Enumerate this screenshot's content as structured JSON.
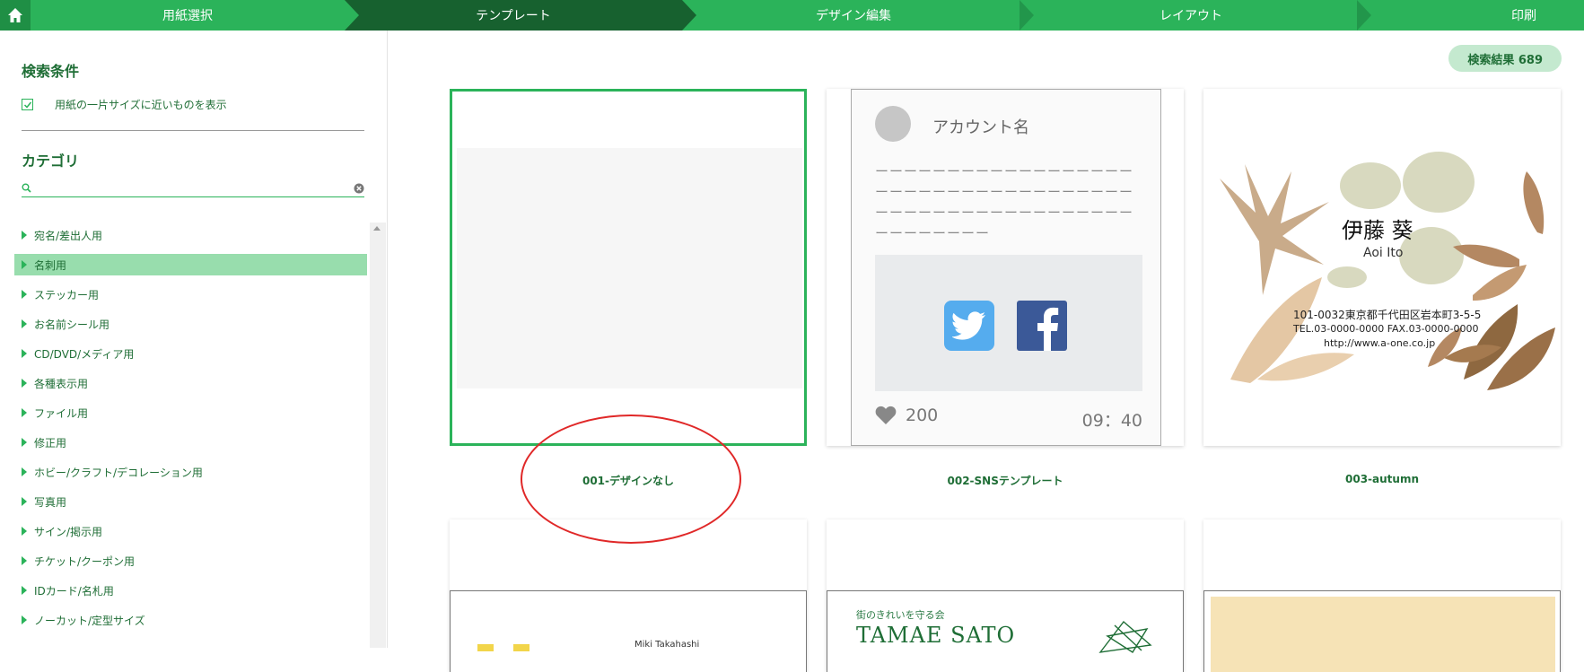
{
  "steps": [
    {
      "label": "用紙選択",
      "active": false
    },
    {
      "label": "テンプレート",
      "active": true
    },
    {
      "label": "デザイン編集",
      "active": false
    },
    {
      "label": "レイアウト",
      "active": false
    },
    {
      "label": "印刷",
      "active": false
    }
  ],
  "sidebar": {
    "search_heading": "検索条件",
    "checkbox_label": "用紙の一片サイズに近いものを表示",
    "category_heading": "カテゴリ",
    "category_search_placeholder": "",
    "categories": [
      {
        "label": "宛名/差出人用",
        "selected": false
      },
      {
        "label": "名刺用",
        "selected": true
      },
      {
        "label": "ステッカー用",
        "selected": false
      },
      {
        "label": "お名前シール用",
        "selected": false
      },
      {
        "label": "CD/DVD/メディア用",
        "selected": false
      },
      {
        "label": "各種表示用",
        "selected": false
      },
      {
        "label": "ファイル用",
        "selected": false
      },
      {
        "label": "修正用",
        "selected": false
      },
      {
        "label": "ホビー/クラフト/デコレーション用",
        "selected": false
      },
      {
        "label": "写真用",
        "selected": false
      },
      {
        "label": "サイン/掲示用",
        "selected": false
      },
      {
        "label": "チケット/クーポン用",
        "selected": false
      },
      {
        "label": "IDカード/名札用",
        "selected": false
      },
      {
        "label": "ノーカット/定型サイズ",
        "selected": false
      }
    ]
  },
  "results": {
    "badge": "検索結果 689"
  },
  "templates": [
    {
      "label": "001-デザインなし",
      "selected": true
    },
    {
      "label": "002-SNSテンプレート",
      "selected": false,
      "account": "アカウント名",
      "dashes": "ーーーーーーーーーーーーーーーーーーーーーーーーーーーーーーーーーーーーーーーーーーーーーーーーーーーーーーーーーーーーーー",
      "likes": "200",
      "time": "09：40"
    },
    {
      "label": "003-autumn",
      "selected": false,
      "name": "伊藤 葵",
      "roman": "Aoi Ito",
      "address": "101-0032東京都千代田区岩本町3-5-5",
      "tel": "TEL.03-0000-0000   FAX.03-0000-0000",
      "url": "http://www.a-one.co.jp"
    }
  ],
  "row2": [
    {
      "text": "Miki Takahashi"
    },
    {
      "sub": "街のきれいを守る会",
      "title": "TAMAE SATO"
    },
    {}
  ],
  "colors": {
    "brand_green": "#2bb35a",
    "active_step": "#17612f",
    "selected_category": "#98ddad",
    "annotation_red": "#e02828"
  }
}
